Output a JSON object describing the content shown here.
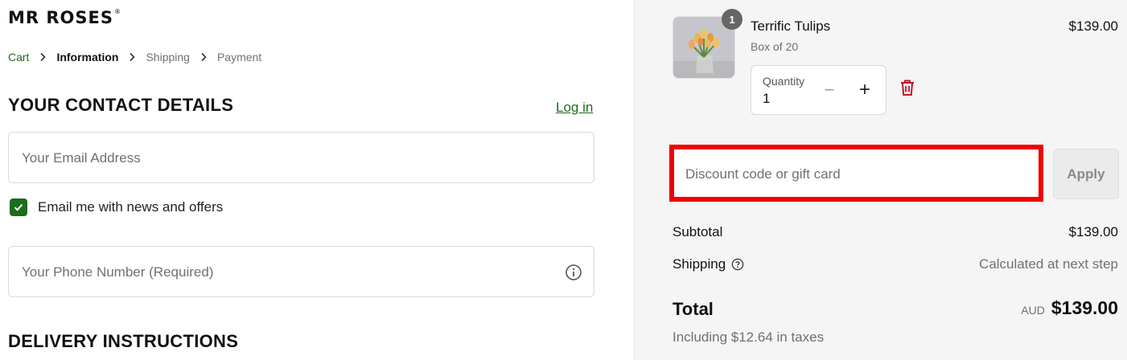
{
  "brand": {
    "name": "MR ROSES",
    "mark": "®"
  },
  "breadcrumb": {
    "items": [
      {
        "label": "Cart",
        "state": "link"
      },
      {
        "label": "Information",
        "state": "current"
      },
      {
        "label": "Shipping",
        "state": "upcoming"
      },
      {
        "label": "Payment",
        "state": "upcoming"
      }
    ]
  },
  "contact": {
    "title": "YOUR CONTACT DETAILS",
    "login_label": "Log in",
    "email_placeholder": "Your Email Address",
    "email_value": "",
    "newsletter_label": "Email me with news and offers",
    "newsletter_checked": true,
    "phone_placeholder": "Your Phone Number (Required)",
    "phone_value": ""
  },
  "delivery": {
    "title": "DELIVERY INSTRUCTIONS"
  },
  "cart": {
    "item": {
      "quantity_badge": "1",
      "name": "Terrific Tulips",
      "variant": "Box of 20",
      "price": "$139.00",
      "quantity_label": "Quantity",
      "quantity_value": "1",
      "decrease_symbol": "−",
      "increase_symbol": "+"
    },
    "discount": {
      "placeholder": "Discount code or gift card",
      "apply_label": "Apply"
    },
    "summary": {
      "subtotal_label": "Subtotal",
      "subtotal_value": "$139.00",
      "shipping_label": "Shipping",
      "shipping_value": "Calculated at next step",
      "total_label": "Total",
      "total_currency": "AUD",
      "total_value": "$139.00",
      "tax_note": "Including $12.64 in taxes"
    }
  },
  "colors": {
    "accent_green": "#1e6b1e",
    "highlight_red": "#ef0000",
    "panel_bg": "#f5f5f5",
    "delete_red": "#c0142a"
  },
  "icons": {
    "breadcrumb_separator": "chevron-right-icon",
    "phone_info": "info-icon",
    "newsletter_check": "check-icon",
    "remove_item": "trash-icon",
    "shipping_help": "question-circle-icon"
  }
}
